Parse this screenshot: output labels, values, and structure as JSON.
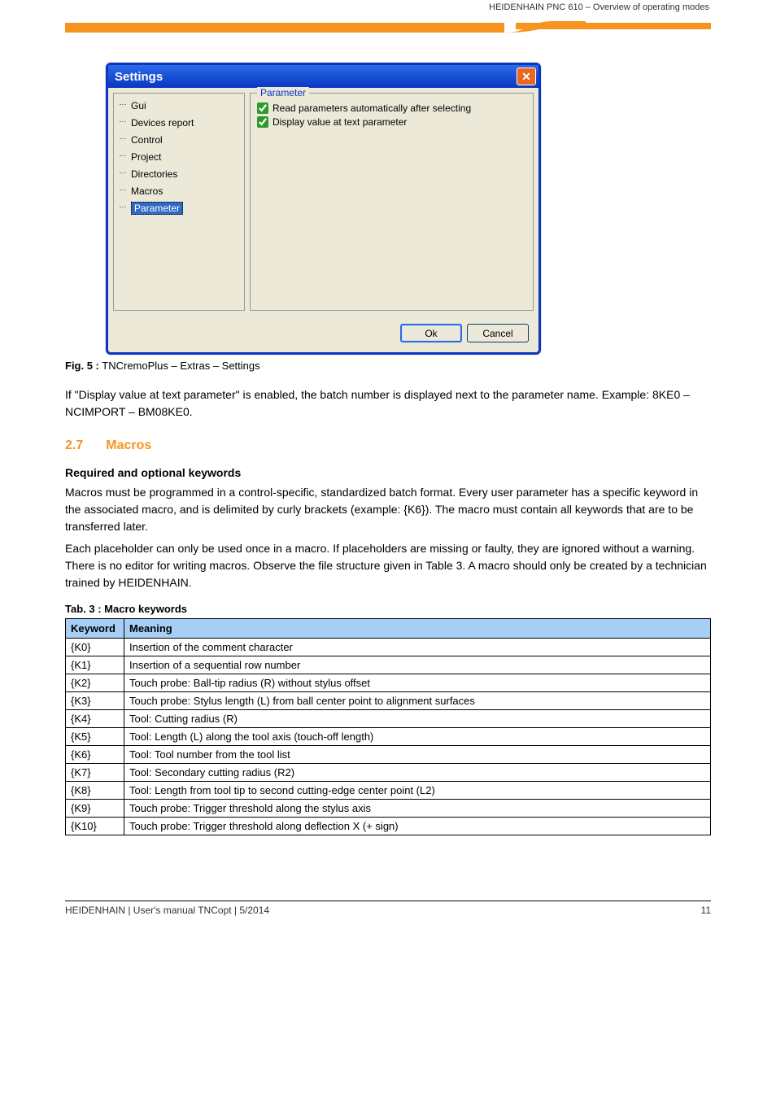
{
  "breadcrumb": "HEIDENHAIN PNC 610 – Overview of operating modes",
  "dialog": {
    "title": "Settings",
    "close": "✕",
    "group_legend": "Parameter",
    "tree": {
      "items": [
        {
          "label": "Gui"
        },
        {
          "label": "Devices report"
        },
        {
          "label": "Control"
        },
        {
          "label": "Project"
        },
        {
          "label": "Directories"
        },
        {
          "label": "Macros"
        },
        {
          "label": "Parameter",
          "selected": true
        }
      ]
    },
    "checkboxes": {
      "c1": "Read parameters automatically after selecting",
      "c2": "Display value at text parameter"
    },
    "ok": "Ok",
    "cancel": "Cancel"
  },
  "caption_prefix": "Fig. 5 :",
  "caption_text": "TNCremoPlus – Extras – Settings",
  "desc1": "If \"Display value at text parameter\" is enabled, the batch number is displayed next to the parameter name. Example: 8KE0 – NCIMPORT – BM08KE0.",
  "section_num": "2.7",
  "section_title": "Macros",
  "sub_title": "Required and optional keywords",
  "para1": "Macros must be programmed in a control-specific, standardized batch format. Every user parameter has a specific keyword in the associated macro, and is delimited by curly brackets (example: {K6}). The macro must contain all keywords that are to be transferred later.",
  "para2": "Each placeholder can only be used once in a macro. If placeholders are missing or faulty, they are ignored without a warning. There is no editor for writing macros. Observe the file structure given in Table 3. A macro should only be created by a technician trained by HEIDENHAIN.",
  "table": {
    "caption": "Tab. 3 :  Macro keywords",
    "headers": {
      "h1": "Keyword",
      "h2": "Meaning"
    },
    "rows": [
      {
        "k": "{K0}",
        "m": "Insertion of the comment character"
      },
      {
        "k": "{K1}",
        "m": "Insertion of a sequential row number"
      },
      {
        "k": "{K2}",
        "m": "Touch probe: Ball-tip radius (R) without stylus offset"
      },
      {
        "k": "{K3}",
        "m": "Touch probe: Stylus length (L) from ball center point to alignment surfaces"
      },
      {
        "k": "{K4}",
        "m": "Tool: Cutting radius (R)"
      },
      {
        "k": "{K5}",
        "m": "Tool: Length (L) along the tool axis (touch-off length)"
      },
      {
        "k": "{K6}",
        "m": "Tool: Tool number from the tool list"
      },
      {
        "k": "{K7}",
        "m": "Tool: Secondary cutting radius (R2)"
      },
      {
        "k": "{K8}",
        "m": "Tool: Length from tool tip to second cutting-edge center point (L2)"
      },
      {
        "k": "{K9}",
        "m": "Touch probe: Trigger threshold along the stylus axis"
      },
      {
        "k": "{K10}",
        "m": "Touch probe: Trigger threshold along deflection X (+ sign)"
      }
    ]
  },
  "footer": {
    "left": "HEIDENHAIN | User's manual TNCopt | 5/2014",
    "right": "11"
  }
}
